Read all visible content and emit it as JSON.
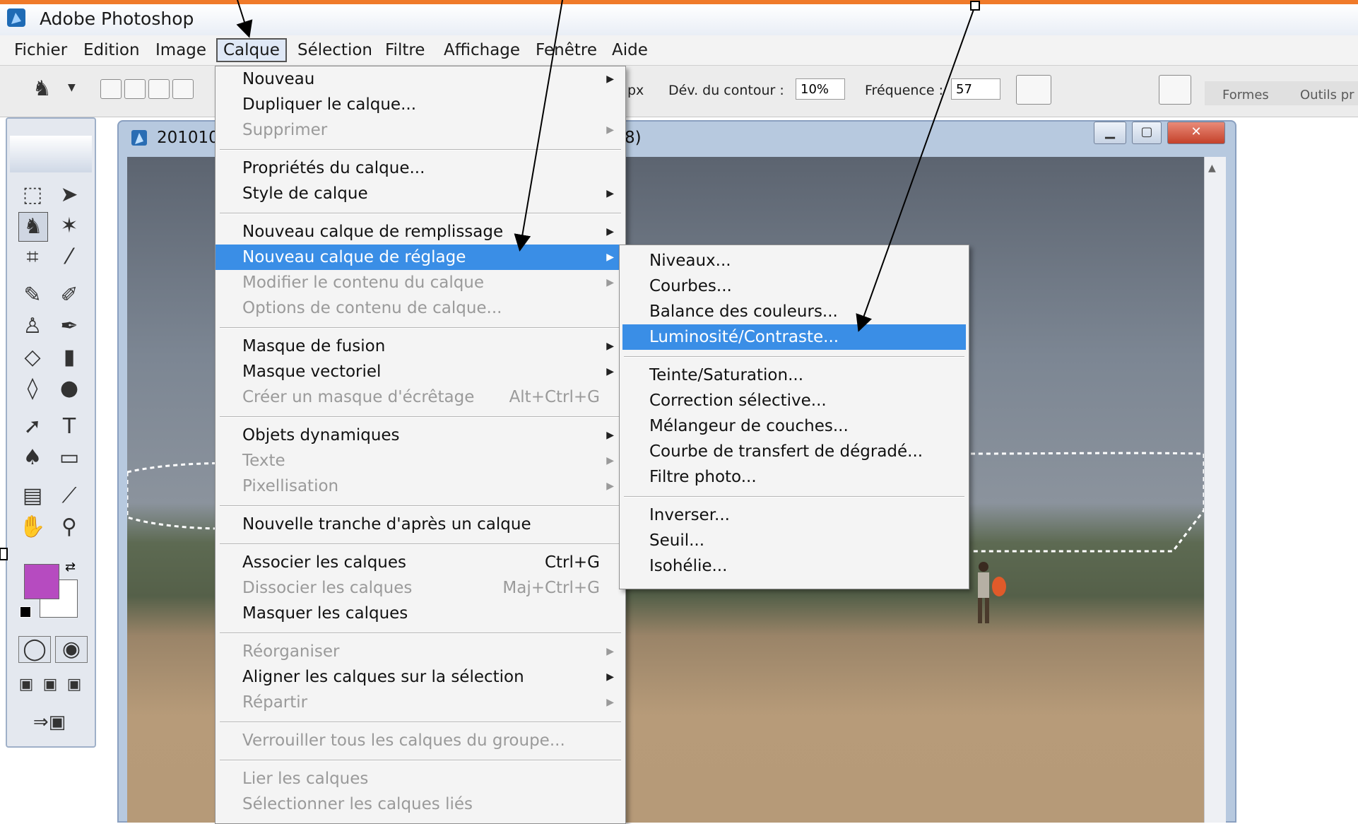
{
  "app": {
    "title": "Adobe Photoshop"
  },
  "menubar": [
    "Fichier",
    "Edition",
    "Image",
    "Calque",
    "Sélection",
    "Filtre",
    "Affichage",
    "Fenêtre",
    "Aide"
  ],
  "options": {
    "dev_label": "Dév. du contour :",
    "dev_value": "10%",
    "freq_label": "Fréquence :",
    "freq_value": "57",
    "px_fragment": "px"
  },
  "palette_tabs": [
    "Formes",
    "Outils pr"
  ],
  "document": {
    "title_prefix": "201010",
    "title_suffix": "8)"
  },
  "colors": {
    "foreground": "#b64bc0",
    "background": "#ffffff",
    "highlight": "#3a8ee6",
    "arrow": "#000000"
  },
  "layer_menu": [
    {
      "label": "Nouveau",
      "arrow": true
    },
    {
      "label": "Dupliquer le calque...",
      "arrow": false
    },
    {
      "label": "Supprimer",
      "arrow": true,
      "disabled": true
    },
    {
      "sep": true
    },
    {
      "label": "Propriétés du calque...",
      "arrow": false
    },
    {
      "label": "Style de calque",
      "arrow": true
    },
    {
      "sep": true
    },
    {
      "label": "Nouveau calque de remplissage",
      "arrow": true
    },
    {
      "label": "Nouveau calque de réglage",
      "arrow": true,
      "highlight": true
    },
    {
      "label": "Modifier le contenu du calque",
      "arrow": true,
      "disabled": true
    },
    {
      "label": "Options de contenu de calque...",
      "arrow": false,
      "disabled": true
    },
    {
      "sep": true
    },
    {
      "label": "Masque de fusion",
      "arrow": true
    },
    {
      "label": "Masque vectoriel",
      "arrow": true
    },
    {
      "label": "Créer un masque d'écrêtage",
      "shortcut": "Alt+Ctrl+G",
      "disabled": true
    },
    {
      "sep": true
    },
    {
      "label": "Objets dynamiques",
      "arrow": true
    },
    {
      "label": "Texte",
      "arrow": true,
      "disabled": true
    },
    {
      "label": "Pixellisation",
      "arrow": true,
      "disabled": true
    },
    {
      "sep": true
    },
    {
      "label": "Nouvelle tranche d'après un calque",
      "arrow": false
    },
    {
      "sep": true
    },
    {
      "label": "Associer les calques",
      "shortcut": "Ctrl+G"
    },
    {
      "label": "Dissocier les calques",
      "shortcut": "Maj+Ctrl+G",
      "disabled": true
    },
    {
      "label": "Masquer les calques",
      "arrow": false
    },
    {
      "sep": true
    },
    {
      "label": "Réorganiser",
      "arrow": true,
      "disabled": true
    },
    {
      "label": "Aligner les calques sur la sélection",
      "arrow": true
    },
    {
      "label": "Répartir",
      "arrow": true,
      "disabled": true
    },
    {
      "sep": true
    },
    {
      "label": "Verrouiller tous les calques du groupe...",
      "disabled": true
    },
    {
      "sep": true
    },
    {
      "label": "Lier les calques",
      "disabled": true
    },
    {
      "label": "Sélectionner les calques liés",
      "disabled": true
    }
  ],
  "adjust_menu": [
    {
      "label": "Niveaux..."
    },
    {
      "label": "Courbes..."
    },
    {
      "label": "Balance des couleurs..."
    },
    {
      "label": "Luminosité/Contraste...",
      "highlight": true
    },
    {
      "sep": true
    },
    {
      "label": "Teinte/Saturation..."
    },
    {
      "label": "Correction sélective..."
    },
    {
      "label": "Mélangeur de couches..."
    },
    {
      "label": "Courbe de transfert de dégradé..."
    },
    {
      "label": "Filtre photo..."
    },
    {
      "sep": true
    },
    {
      "label": "Inverser..."
    },
    {
      "label": "Seuil..."
    },
    {
      "label": "Isohélie..."
    }
  ]
}
